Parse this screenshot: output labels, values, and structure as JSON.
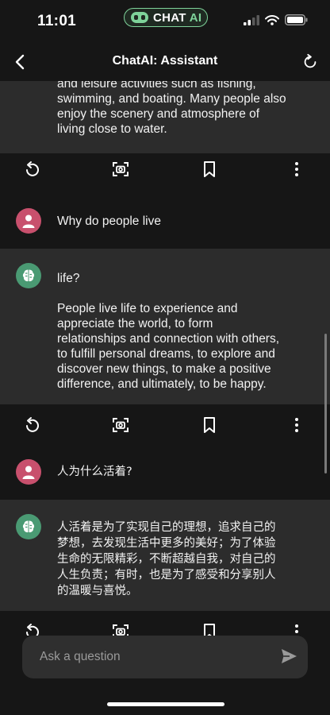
{
  "status_bar": {
    "time": "11:01",
    "badge_text": "CHAT",
    "badge_accent": "AI",
    "badge_color": "#7ed39a"
  },
  "header": {
    "title": "ChatAI: Assistant"
  },
  "messages": [
    {
      "role": "assistant",
      "text": "and leisure activities such as fishing,\nswimming, and boating. Many people also\nenjoy the scenery and atmosphere of\nliving close to water."
    },
    {
      "role": "user",
      "text": "Why do people live"
    },
    {
      "role": "assistant",
      "text": "life?\n\nPeople live life to experience and\nappreciate the world, to form\nrelationships and connection with others,\nto fulfill personal dreams, to explore and\ndiscover new things, to make a positive\ndifference, and ultimately, to be happy."
    },
    {
      "role": "user",
      "text": "人为什么活着?"
    },
    {
      "role": "assistant",
      "text": "人活着是为了实现自己的理想，追求自己的\n梦想，去发现生活中更多的美好；为了体验\n生命的无限精彩，不断超越自我，对自己的\n人生负责；有时，也是为了感受和分享别人\n的温暖与喜悦。"
    }
  ],
  "actions": {
    "icons": [
      "undo-icon",
      "screenshot-icon",
      "bookmark-icon",
      "more-icon"
    ]
  },
  "input": {
    "placeholder": "Ask a question",
    "value": ""
  },
  "colors": {
    "background": "#161616",
    "assistant_bubble": "#2c2c2c",
    "user_avatar": "#c8506d",
    "assistant_avatar": "#4a9a73"
  }
}
